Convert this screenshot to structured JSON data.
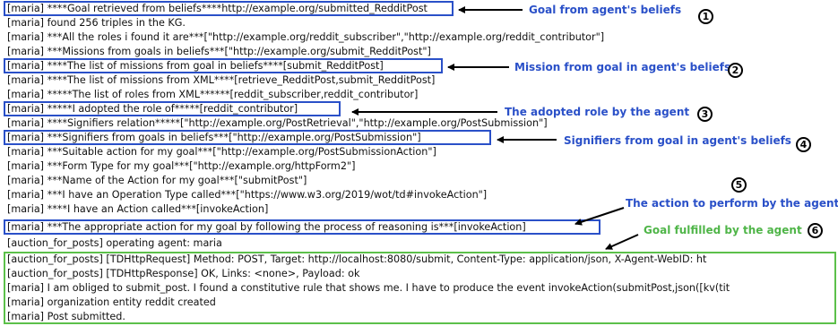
{
  "log_lines": [
    "[maria] ****Goal retrieved from beliefs****http://example.org/submitted_RedditPost",
    "[maria] found 256 triples in the KG.",
    "[maria] ***All the roles i found it are***[\"http://example.org/reddit_subscriber\",\"http://example.org/reddit_contributor\"]",
    "[maria] ***Missions from goals in beliefs***[\"http://example.org/submit_RedditPost\"]",
    "[maria] ****The list of missions from goal in beliefs****[submit_RedditPost]",
    "[maria] ****The list of missions from XML****[retrieve_RedditPost,submit_RedditPost]",
    "[maria] *****The list of roles from XML******[reddit_subscriber,reddit_contributor]",
    "[maria] *****I adopted the role of*****[reddit_contributor]",
    "[maria] ****Signifiers relation*****[\"http://example.org/PostRetrieval\",\"http://example.org/PostSubmission\"]",
    "[maria] ***Signifiers from goals in beliefs***[\"http://example.org/PostSubmission\"]",
    "[maria] ***Suitable action for my goal***[\"http://example.org/PostSubmissionAction\"]",
    "[maria] ***Form Type for my goal***[\"http://example.org/httpForm2\"]",
    "[maria] ***Name of the Action for my goal***[\"submitPost\"]",
    "[maria] ***I have an Operation Type called***[\"https://www.w3.org/2019/wot/td#invokeAction\"]",
    "[maria] ****I have an Action called***[invokeAction]",
    "[maria] ***The appropriate action for my goal by following the process of reasoning is***[invokeAction]",
    "[auction_for_posts] operating agent: maria",
    "[auction_for_posts] [TDHttpRequest] Method: POST, Target: http://localhost:8080/submit, Content-Type: application/json, X-Agent-WebID: ht",
    "[auction_for_posts] [TDHttpResponse] OK, Links: <none>, Payload: ok",
    "[maria] I am obliged to submit_post. I found a constitutive rule that shows me. I have to produce the event invokeAction(submitPost,json([kv(tit",
    "[maria] organization entity reddit created",
    "[maria] Post submitted."
  ],
  "annotations": {
    "goal_from_beliefs": "Goal from agent's beliefs",
    "mission_from_goal": "Mission from goal in agent's beliefs",
    "adopted_role": "The adopted role by the agent",
    "signifiers_from_goal": "Signifiers from goal in agent's beliefs",
    "action_to_perform": "The action to perform by the agent",
    "goal_fulfilled": "Goal fulfilled by the agent"
  },
  "step_numbers": [
    "1",
    "2",
    "3",
    "4",
    "5",
    "6"
  ],
  "colors": {
    "highlight_blue": "#2a50c8",
    "highlight_green": "#5cc04a",
    "annotation_green": "#4fb548",
    "text": "#111111"
  }
}
